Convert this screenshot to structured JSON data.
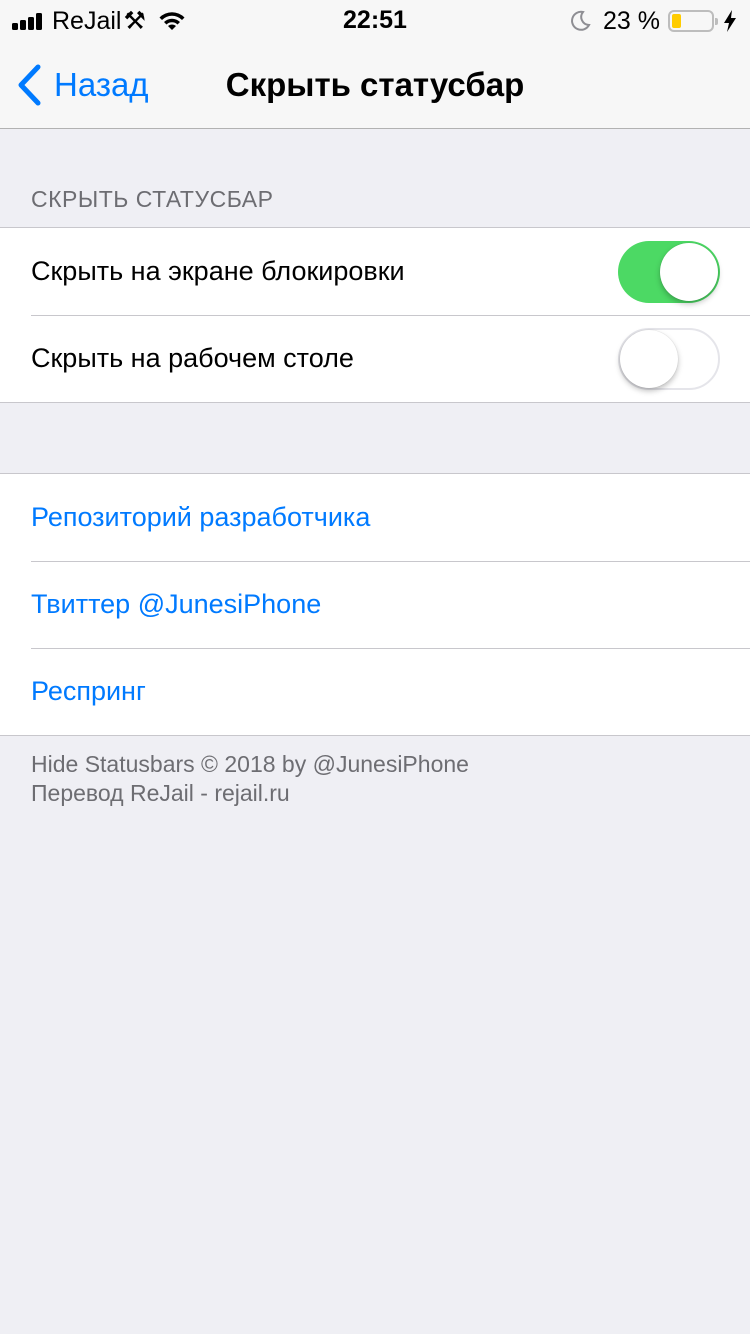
{
  "status_bar": {
    "carrier": "ReJail",
    "carrier_icon": "⚒",
    "time": "22:51",
    "battery_percent": "23 %",
    "battery_level": 0.23,
    "battery_color": "#ffcc00"
  },
  "nav": {
    "back_label": "Назад",
    "title": "Скрыть статусбар"
  },
  "section": {
    "header": "СКРЫТЬ СТАТУСБАР",
    "toggles": [
      {
        "label": "Скрыть на экране блокировки",
        "on": true
      },
      {
        "label": "Скрыть на рабочем столе",
        "on": false
      }
    ]
  },
  "links": [
    {
      "label": "Репозиторий разработчика"
    },
    {
      "label": "Твиттер @JunesiPhone"
    },
    {
      "label": "Респринг"
    }
  ],
  "footer": {
    "line1": "Hide Statusbars © 2018 by @JunesiPhone",
    "line2": "Перевод ReJail - rejail.ru"
  },
  "colors": {
    "accent": "#007aff",
    "switch_on": "#4cd964",
    "background": "#efeff4"
  }
}
